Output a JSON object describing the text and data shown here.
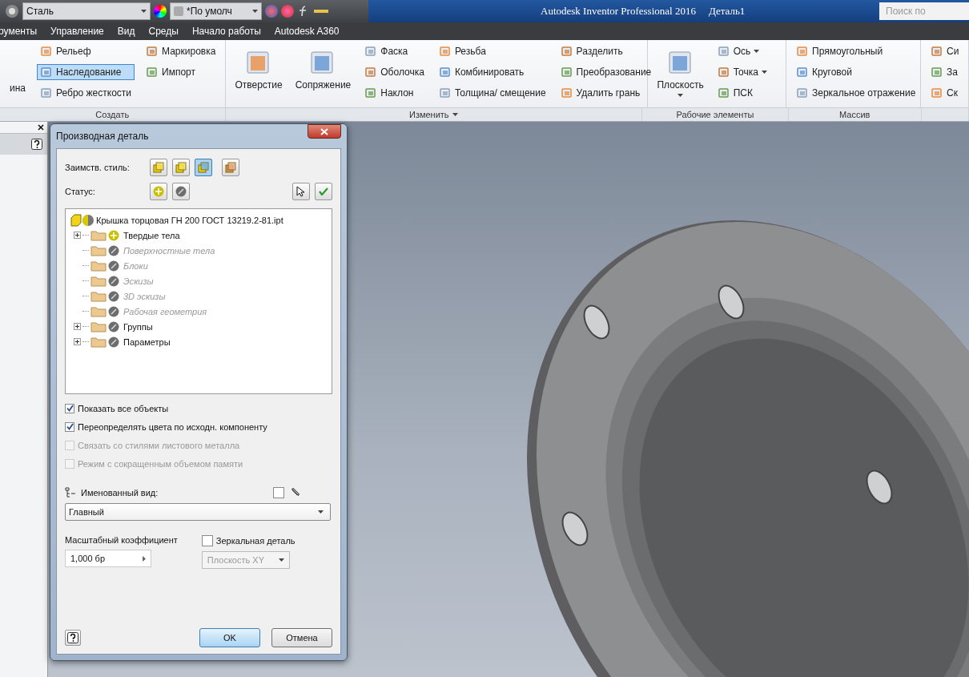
{
  "quick_access": {
    "material": "Сталь",
    "appearance": "*По умолч"
  },
  "title_bar": {
    "app": "Autodesk Inventor Professional 2016",
    "document": "Деталь1",
    "search_placeholder": "Поиск по"
  },
  "menu": [
    "рументы",
    "Управление",
    "Вид",
    "Среды",
    "Начало работы",
    "Autodesk A360"
  ],
  "ribbon": [
    {
      "label": "Создать",
      "columns": [
        {
          "kind": "small",
          "items": [
            {
              "label": "ина",
              "selected": false,
              "kind": "text"
            }
          ]
        },
        {
          "kind": "small",
          "items": [
            {
              "label": "Рельеф",
              "selected": false
            },
            {
              "label": "Наследование",
              "selected": true
            },
            {
              "label": "Ребро жесткости",
              "selected": false
            }
          ]
        },
        {
          "kind": "small",
          "items": [
            {
              "label": "Маркировка",
              "selected": false
            },
            {
              "label": "Импорт",
              "selected": false
            }
          ]
        }
      ]
    },
    {
      "label": "Изменить",
      "dropdown": true,
      "columns": [
        {
          "kind": "large",
          "items": [
            {
              "label": "Отверстие",
              "selected": false
            }
          ]
        },
        {
          "kind": "large",
          "items": [
            {
              "label": "Сопряжение",
              "selected": false
            }
          ]
        },
        {
          "kind": "small",
          "items": [
            {
              "label": "Фаска",
              "selected": false
            },
            {
              "label": "Оболочка",
              "selected": false
            },
            {
              "label": "Наклон",
              "selected": false
            }
          ]
        },
        {
          "kind": "small",
          "items": [
            {
              "label": "Резьба",
              "selected": false
            },
            {
              "label": "Комбинировать",
              "selected": false
            },
            {
              "label": "Толщина/ смещение",
              "selected": false
            }
          ]
        },
        {
          "kind": "small",
          "items": [
            {
              "label": "Разделить",
              "selected": false
            },
            {
              "label": "Преобразование",
              "selected": false
            },
            {
              "label": "Удалить грань",
              "selected": false
            }
          ]
        }
      ]
    },
    {
      "label": "Рабочие элементы",
      "columns": [
        {
          "kind": "large",
          "items": [
            {
              "label": "Плоскость",
              "selected": false,
              "dropdown": true
            }
          ]
        },
        {
          "kind": "small",
          "items": [
            {
              "label": "Ось",
              "selected": false,
              "dropdown": true
            },
            {
              "label": "Точка",
              "selected": false,
              "dropdown": true
            },
            {
              "label": "ПСК",
              "selected": false
            }
          ]
        }
      ]
    },
    {
      "label": "Массив",
      "columns": [
        {
          "kind": "small",
          "items": [
            {
              "label": "Прямоугольный",
              "selected": false
            },
            {
              "label": "Круговой",
              "selected": false
            },
            {
              "label": "Зеркальное отражение",
              "selected": false
            }
          ]
        }
      ]
    },
    {
      "columns": [
        {
          "kind": "small",
          "items": [
            {
              "label": "Си",
              "selected": false
            },
            {
              "label": "За",
              "selected": false
            },
            {
              "label": "Ск",
              "selected": false
            }
          ]
        }
      ]
    }
  ],
  "dialog": {
    "title": "Производная деталь",
    "style_label": "Заимств. стиль:",
    "style_buttons": [
      {
        "selected": false
      },
      {
        "selected": false
      },
      {
        "selected": true
      },
      {
        "selected": false
      }
    ],
    "status_label": "Статус:",
    "tree": {
      "label": "Крышка торцовая ГН 200 ГОСТ 13219.2-81.ipt",
      "children": [
        {
          "label": "Твердые тела",
          "included": true,
          "disabled": false,
          "expandable": true
        },
        {
          "label": "Поверхностные тела",
          "included": false,
          "disabled": true,
          "expandable": false
        },
        {
          "label": "Блоки",
          "included": false,
          "disabled": true,
          "expandable": false
        },
        {
          "label": "Эскизы",
          "included": false,
          "disabled": true,
          "expandable": false
        },
        {
          "label": "3D эскизы",
          "included": false,
          "disabled": true,
          "expandable": false
        },
        {
          "label": "Рабочая геометрия",
          "included": false,
          "disabled": true,
          "expandable": false
        },
        {
          "label": "Группы",
          "included": false,
          "disabled": false,
          "expandable": true
        },
        {
          "label": "Параметры",
          "included": false,
          "disabled": false,
          "expandable": true
        }
      ]
    },
    "options": [
      {
        "label": "Показать все объекты",
        "checked": true,
        "disabled": false
      },
      {
        "label": "Переопределять цвета по исходн. компоненту",
        "checked": true,
        "disabled": false
      },
      {
        "label": "Связать со стилями листового металла",
        "checked": false,
        "disabled": true
      },
      {
        "label": "Режим с сокращенным объемом памяти",
        "checked": false,
        "disabled": true
      }
    ],
    "named_view": {
      "label": "Именованный вид:",
      "checked": false,
      "value": "Главный"
    },
    "scale": {
      "label": "Масштабный коэффициент",
      "value": "1,000 бр"
    },
    "mirror": {
      "label": "Зеркальная деталь",
      "checked": false,
      "plane": "Плоскость XY",
      "disabled": true
    },
    "ok": "OK",
    "cancel": "Отмена"
  }
}
